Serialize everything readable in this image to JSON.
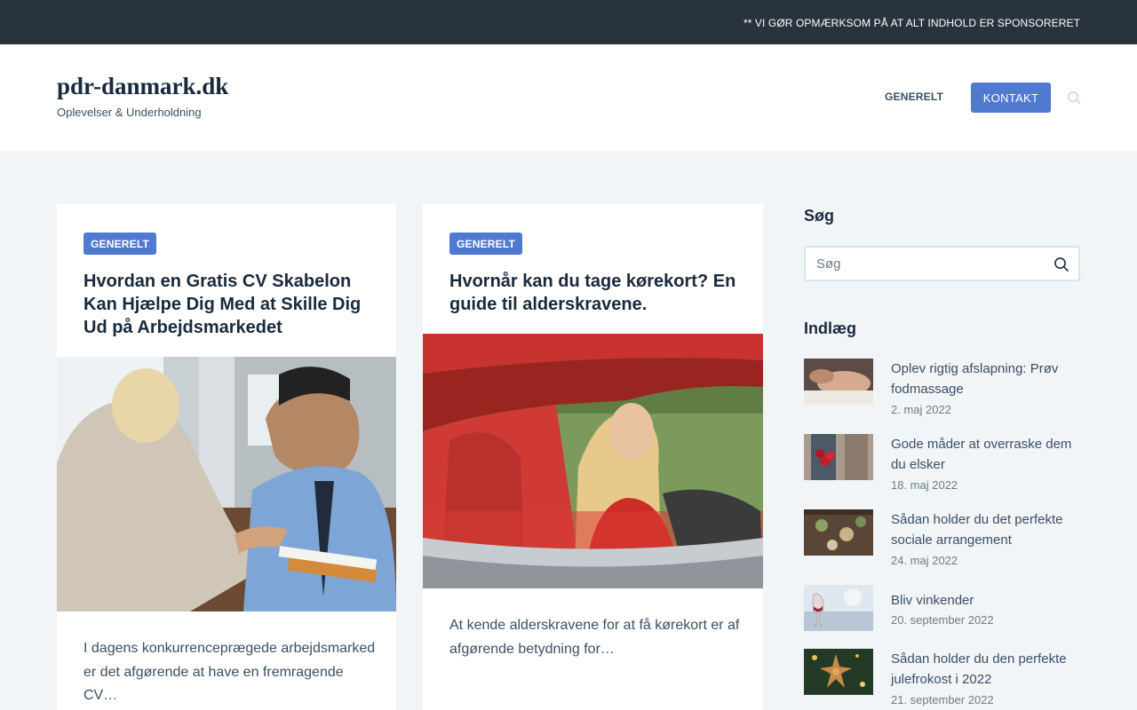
{
  "topbar": {
    "notice": "** VI GØR OPMÆRKSOM PÅ AT ALT INDHOLD ER SPONSORERET"
  },
  "header": {
    "site_title": "pdr-danmark.dk",
    "tagline": "Oplevelser & Underholdning",
    "nav": [
      {
        "label": "GENERELT"
      },
      {
        "label": "KONTAKT"
      }
    ],
    "search_icon": "search-icon"
  },
  "posts": [
    {
      "category": "GENERELT",
      "title": "Hvordan en Gratis CV Skabelon Kan Hjælpe Dig Med at Skille Dig Ud på Arbejdsmarkedet",
      "image": "job-interview-handshake-photo",
      "excerpt": "I dagens konkurrenceprægede arbejdsmarked er det afgørende at have en fremragende CV…"
    },
    {
      "category": "GENERELT",
      "title": "Hvornår kan du tage kørekort? En guide til alderskravene.",
      "image": "woman-driving-red-convertible-photo",
      "excerpt": "At kende alderskravene for at få kørekort er af afgørende betydning for…"
    }
  ],
  "sidebar": {
    "search_heading": "Søg",
    "search_placeholder": "Søg",
    "posts_heading": "Indlæg",
    "recent": [
      {
        "title": "Oplev rigtig afslapning: Prøv fodmassage",
        "date": "2. maj 2022",
        "thumb": "foot-massage-photo"
      },
      {
        "title": "Gode måder at overraske dem du elsker",
        "date": "18. maj 2022",
        "thumb": "roses-surprise-photo"
      },
      {
        "title": "Sådan holder du det perfekte sociale arrangement",
        "date": "24. maj 2022",
        "thumb": "dinner-table-photo"
      },
      {
        "title": "Bliv vinkender",
        "date": "20. september 2022",
        "thumb": "wine-glass-photo"
      },
      {
        "title": "Sådan holder du den perfekte julefrokost i 2022",
        "date": "21. september 2022",
        "thumb": "christmas-star-photo"
      }
    ]
  },
  "colors": {
    "topbar": "#29333e",
    "accent": "#4f7ad0",
    "heading": "#192a3d",
    "text": "#3a4f66",
    "page_bg": "#f2f5f7"
  }
}
